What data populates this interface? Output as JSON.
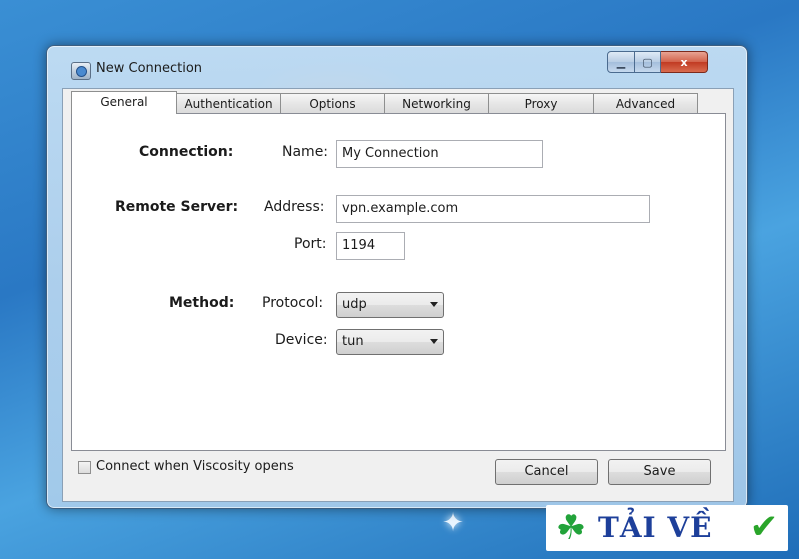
{
  "window": {
    "title": "New Connection",
    "controls": {
      "minimize": "▁",
      "maximize": "▢",
      "close": "x"
    }
  },
  "tabs": [
    {
      "label": "General",
      "active": true
    },
    {
      "label": "Authentication",
      "active": false
    },
    {
      "label": "Options",
      "active": false
    },
    {
      "label": "Networking",
      "active": false
    },
    {
      "label": "Proxy",
      "active": false
    },
    {
      "label": "Advanced",
      "active": false
    }
  ],
  "form": {
    "connection": {
      "section": "Connection:",
      "name_label": "Name:",
      "name_value": "My Connection"
    },
    "remote_server": {
      "section": "Remote Server:",
      "address_label": "Address:",
      "address_value": "vpn.example.com",
      "port_label": "Port:",
      "port_value": "1194"
    },
    "method": {
      "section": "Method:",
      "protocol_label": "Protocol:",
      "protocol_value": "udp",
      "device_label": "Device:",
      "device_value": "tun"
    }
  },
  "footer": {
    "connect_on_open_label": "Connect when Viscosity opens",
    "connect_on_open_checked": false,
    "cancel_label": "Cancel",
    "save_label": "Save"
  },
  "watermark": {
    "text": "TẢI VỀ",
    "check": "✔",
    "clover": "☘"
  },
  "colors": {
    "desktop": "#2a78c4",
    "close_button": "#c13a22",
    "watermark_text": "#1d3f9a",
    "watermark_green": "#22a33a"
  }
}
